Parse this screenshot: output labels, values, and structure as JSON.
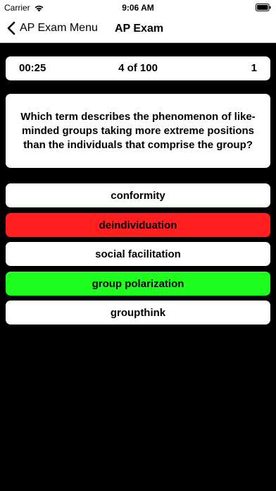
{
  "status_bar": {
    "carrier": "Carrier",
    "time": "9:06 AM",
    "wifi_icon": "wifi-icon",
    "battery_icon": "battery-icon"
  },
  "nav": {
    "back_label": "AP Exam Menu",
    "back_icon": "chevron-left-icon",
    "title": "AP Exam"
  },
  "info": {
    "timer": "00:25",
    "progress": "4 of 100",
    "score": "1"
  },
  "question": {
    "text": "Which term describes the phenomenon of like-minded groups taking more extreme positions than the individuals that comprise the group?"
  },
  "answers": [
    {
      "label": "conformity",
      "state": "default"
    },
    {
      "label": "deindividuation",
      "state": "incorrect"
    },
    {
      "label": "social facilitation",
      "state": "default"
    },
    {
      "label": "group polarization",
      "state": "correct"
    },
    {
      "label": "groupthink",
      "state": "default"
    }
  ],
  "colors": {
    "background": "#000000",
    "card": "#ffffff",
    "incorrect": "#ff1f1f",
    "correct": "#1fff1f"
  }
}
